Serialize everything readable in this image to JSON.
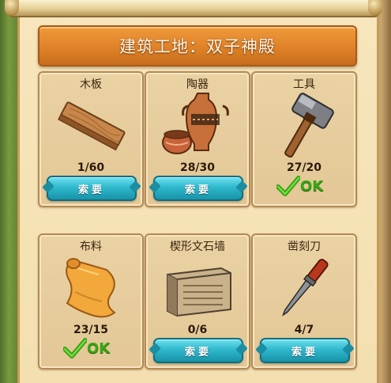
{
  "title": "建筑工地：双子神殿",
  "items": [
    {
      "name": "木板",
      "count": "1/60",
      "status": "request",
      "button_label": "索要",
      "icon": "wood-plank-icon"
    },
    {
      "name": "陶器",
      "count": "28/30",
      "status": "request",
      "button_label": "索要",
      "icon": "pottery-icon"
    },
    {
      "name": "工具",
      "count": "27/20",
      "status": "ok",
      "ok_label": "OK",
      "icon": "hammer-icon"
    },
    {
      "name": "布料",
      "count": "23/15",
      "status": "ok",
      "ok_label": "OK",
      "icon": "cloth-roll-icon"
    },
    {
      "name": "楔形文石墙",
      "count": "0/6",
      "status": "request",
      "button_label": "索要",
      "icon": "cuneiform-wall-icon"
    },
    {
      "name": "凿刻刀",
      "count": "4/7",
      "status": "request",
      "button_label": "索要",
      "icon": "chisel-icon"
    }
  ],
  "colors": {
    "button": "#2fb8cd",
    "ok": "#3aa515",
    "title_bar": "#e1842a"
  }
}
